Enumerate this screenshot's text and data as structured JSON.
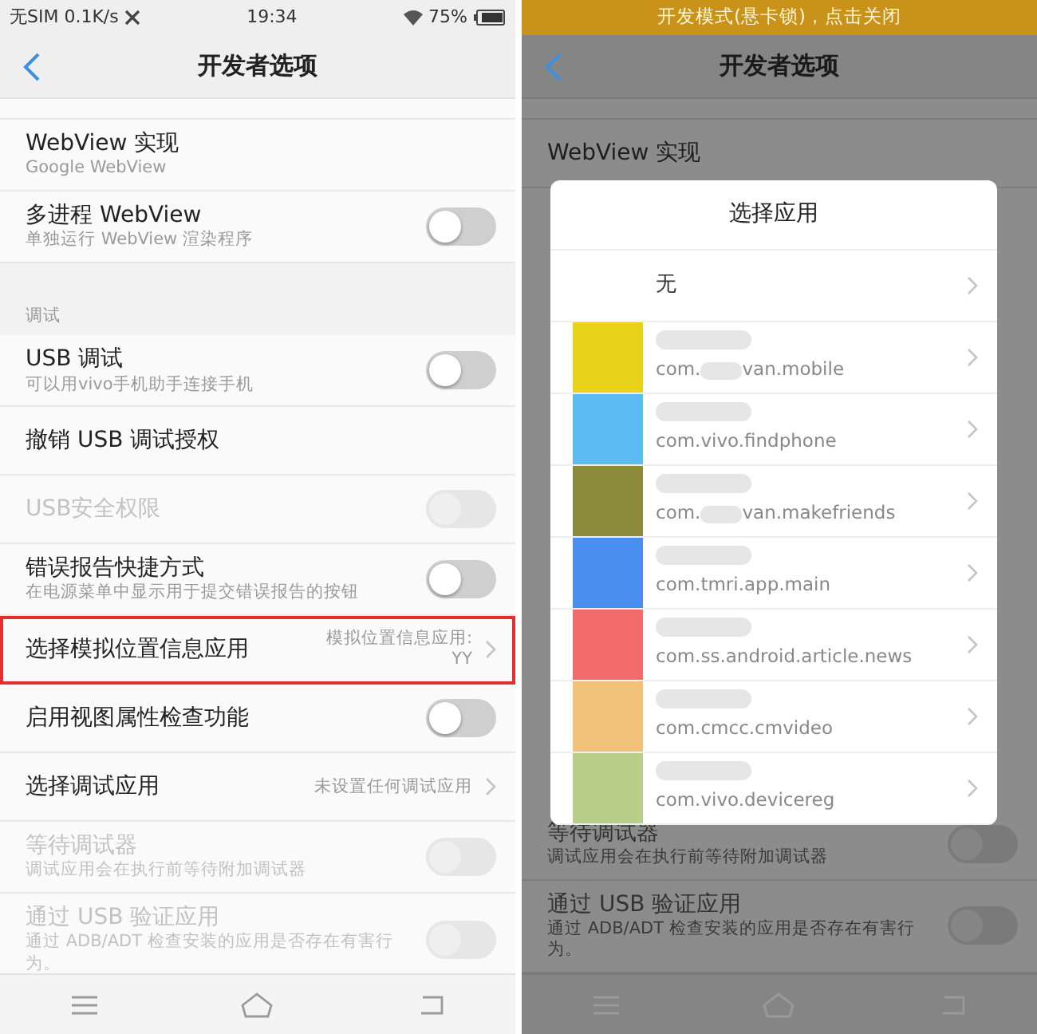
{
  "left_screen": {
    "status_bar": {
      "carrier": "无SIM 0.1K/s",
      "time": "19:34",
      "battery": "75%"
    },
    "header": {
      "title": "开发者选项"
    },
    "rows": [
      {
        "kind": "plain",
        "title": "WebView 实现",
        "subtitle": "Google WebView",
        "highlighted": false
      },
      {
        "kind": "toggle",
        "title": "多进程 WebView",
        "subtitle": "单独运行 WebView 渲染程序",
        "on": false,
        "disabled": false,
        "highlighted": false
      },
      {
        "kind": "section",
        "title": "调试"
      },
      {
        "kind": "toggle",
        "title": "USB 调试",
        "subtitle": "可以用vivo手机助手连接手机",
        "on": false,
        "disabled": false,
        "highlighted": false
      },
      {
        "kind": "plain",
        "title": "撤销 USB 调试授权",
        "highlighted": false
      },
      {
        "kind": "toggle",
        "title": "USB安全权限",
        "on": false,
        "disabled": true,
        "highlighted": false
      },
      {
        "kind": "toggle",
        "title": "错误报告快捷方式",
        "subtitle": "在电源菜单中显示用于提交错误报告的按钮",
        "on": false,
        "disabled": false,
        "highlighted": false
      },
      {
        "kind": "link",
        "title": "选择模拟位置信息应用",
        "value_lines": [
          "模拟位置信息应用:",
          "YY"
        ],
        "highlighted": true
      },
      {
        "kind": "toggle",
        "title": "启用视图属性检查功能",
        "on": false,
        "disabled": false,
        "highlighted": false
      },
      {
        "kind": "link",
        "title": "选择调试应用",
        "value_lines": [
          "未设置任何调试应用"
        ],
        "highlighted": false
      },
      {
        "kind": "toggle",
        "title": "等待调试器",
        "subtitle": "调试应用会在执行前等待附加调试器",
        "on": false,
        "disabled": true,
        "highlighted": false
      },
      {
        "kind": "toggle",
        "title": "通过 USB 验证应用",
        "subtitle": "通过 ADB/ADT 检查安装的应用是否存在有害行为。",
        "on": false,
        "disabled": true,
        "highlighted": false
      }
    ]
  },
  "right_screen": {
    "banner": "开发模式(悬卡锁)，点击关闭",
    "header": {
      "title": "开发者选项"
    },
    "rows_top": [
      {
        "kind": "plain",
        "title": "WebView 实现",
        "highlighted": false
      }
    ],
    "rows_bottom": [
      {
        "kind": "toggle",
        "title": "等待调试器",
        "subtitle": "调试应用会在执行前等待附加调试器",
        "on": false,
        "disabled": true,
        "highlighted": false
      },
      {
        "kind": "toggle",
        "title": "通过 USB 验证应用",
        "subtitle": "通过 ADB/ADT 检查安装的应用是否存在有害行为。",
        "on": false,
        "disabled": true,
        "highlighted": false
      }
    ],
    "dialog": {
      "title": "选择应用",
      "apps": [
        {
          "kind": "none",
          "label": "无"
        },
        {
          "kind": "app",
          "color": "#e8d21a",
          "package_parts": [
            "com.",
            "van.mobile"
          ]
        },
        {
          "kind": "app",
          "color": "#5bbcf2",
          "package_parts": [
            "com.vivo.findphone"
          ]
        },
        {
          "kind": "app",
          "color": "#8a8a3a",
          "package_parts": [
            "com.",
            "van.makefriends"
          ]
        },
        {
          "kind": "app",
          "color": "#4a8ff0",
          "package_parts": [
            "com.tmri.app.main"
          ]
        },
        {
          "kind": "app",
          "color": "#f26a6a",
          "package_parts": [
            "com.ss.android.article.news"
          ]
        },
        {
          "kind": "app",
          "color": "#f2c27a",
          "package_parts": [
            "com.cmcc.cmvideo"
          ]
        },
        {
          "kind": "app",
          "color": "#b8cf8a",
          "package_parts": [
            "com.vivo.devicereg"
          ]
        }
      ]
    }
  }
}
